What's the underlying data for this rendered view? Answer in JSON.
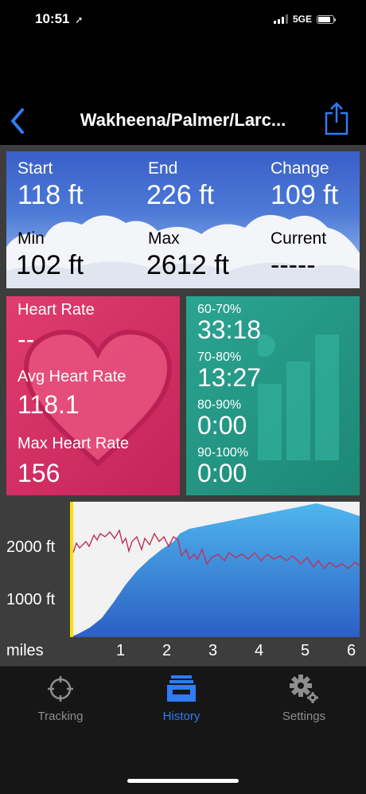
{
  "status_bar": {
    "time": "10:51",
    "network": "5GE"
  },
  "nav": {
    "title": "Wakheena/Palmer/Larc..."
  },
  "elevation": {
    "start_label": "Start",
    "start_value": "118 ft",
    "end_label": "End",
    "end_value": "226 ft",
    "change_label": "Change",
    "change_value": "109 ft",
    "min_label": "Min",
    "min_value": "102 ft",
    "max_label": "Max",
    "max_value": "2612 ft",
    "current_label": "Current",
    "current_value": "-----"
  },
  "heart_rate": {
    "hr_label": "Heart Rate",
    "hr_value": "--",
    "avg_label": "Avg Heart Rate",
    "avg_value": "118.1",
    "max_label": "Max Heart Rate",
    "max_value": "156"
  },
  "zones": [
    {
      "label": "60-70%",
      "value": "33:18"
    },
    {
      "label": "70-80%",
      "value": "13:27"
    },
    {
      "label": "80-90%",
      "value": "0:00"
    },
    {
      "label": "90-100%",
      "value": "0:00"
    }
  ],
  "chart": {
    "y_labels": [
      "2000 ft",
      "1000 ft"
    ],
    "x_unit": "miles",
    "x_ticks": [
      "1",
      "2",
      "3",
      "4",
      "5",
      "6"
    ]
  },
  "tabs": [
    {
      "label": "Tracking",
      "icon": "crosshair-icon",
      "active": false
    },
    {
      "label": "History",
      "icon": "inbox-tray-icon",
      "active": true
    },
    {
      "label": "Settings",
      "icon": "gears-icon",
      "active": false
    }
  ],
  "colors": {
    "accent": "#2f7cf6",
    "heart_panel": "#d6336a",
    "zones_panel": "#23977f",
    "elevation_fill": "#3a85d8",
    "hr_line": "#c0305a"
  }
}
